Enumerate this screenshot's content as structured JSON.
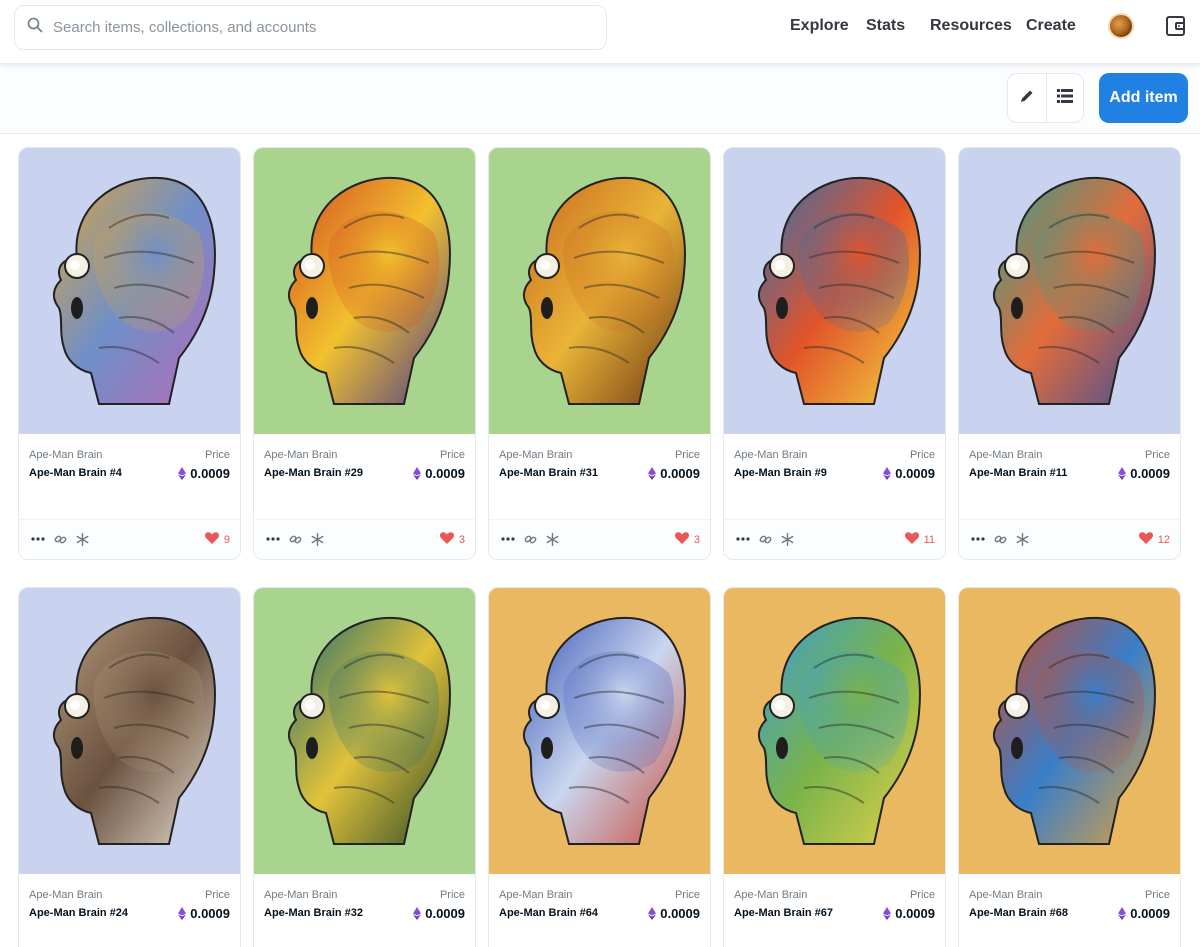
{
  "nav": {
    "search_placeholder": "Search items, collections, and accounts",
    "links": [
      "Explore",
      "Stats",
      "Resources",
      "Create"
    ]
  },
  "toolbar": {
    "add_item_label": "Add item"
  },
  "colors": {
    "accent": "#2081e2",
    "heart": "#eb5757",
    "bg_blue": "#c9d2ee",
    "bg_green": "#a9d48e",
    "bg_orange": "#ebb862"
  },
  "price_label": "Price",
  "cards": [
    {
      "collection": "Ape-Man Brain",
      "name": "Ape-Man Brain #4",
      "price": "0.0009",
      "likes": "9",
      "bg": "#c9d2ee",
      "palette": [
        "#d9a441",
        "#6f8fc9",
        "#b66bb5"
      ]
    },
    {
      "collection": "Ape-Man Brain",
      "name": "Ape-Man Brain #29",
      "price": "0.0009",
      "likes": "3",
      "bg": "#a9d48e",
      "palette": [
        "#d24a1f",
        "#f2c12e",
        "#4b3c8a"
      ]
    },
    {
      "collection": "Ape-Man Brain",
      "name": "Ape-Man Brain #31",
      "price": "0.0009",
      "likes": "3",
      "bg": "#a9d48e",
      "palette": [
        "#c8681e",
        "#e9b437",
        "#6b3514"
      ]
    },
    {
      "collection": "Ape-Man Brain",
      "name": "Ape-Man Brain #9",
      "price": "0.0009",
      "likes": "11",
      "bg": "#c9d2ee",
      "palette": [
        "#2c6fb5",
        "#e2542a",
        "#f2d23d"
      ]
    },
    {
      "collection": "Ape-Man Brain",
      "name": "Ape-Man Brain #11",
      "price": "0.0009",
      "likes": "12",
      "bg": "#c9d2ee",
      "palette": [
        "#2f9e8f",
        "#e36c3a",
        "#3d4e9c"
      ]
    },
    {
      "collection": "Ape-Man Brain",
      "name": "Ape-Man Brain #24",
      "price": "0.0009",
      "likes": "",
      "bg": "#c9d2ee",
      "palette": [
        "#b59a7a",
        "#6b5240",
        "#e8ddd0"
      ]
    },
    {
      "collection": "Ape-Man Brain",
      "name": "Ape-Man Brain #32",
      "price": "0.0009",
      "likes": "",
      "bg": "#a9d48e",
      "palette": [
        "#1f6b6f",
        "#e2c23a",
        "#2a4a2a"
      ]
    },
    {
      "collection": "Ape-Man Brain",
      "name": "Ape-Man Brain #64",
      "price": "0.0009",
      "likes": "",
      "bg": "#ebb862",
      "palette": [
        "#3a56b5",
        "#c9d6ef",
        "#c94b3a"
      ]
    },
    {
      "collection": "Ape-Man Brain",
      "name": "Ape-Man Brain #67",
      "price": "0.0009",
      "likes": "",
      "bg": "#ebb862",
      "palette": [
        "#3a9ed6",
        "#7ab34a",
        "#e2d24a"
      ]
    },
    {
      "collection": "Ape-Man Brain",
      "name": "Ape-Man Brain #68",
      "price": "0.0009",
      "likes": "",
      "bg": "#ebb862",
      "palette": [
        "#c94b2a",
        "#3a7ec9",
        "#e2a23a"
      ]
    }
  ]
}
